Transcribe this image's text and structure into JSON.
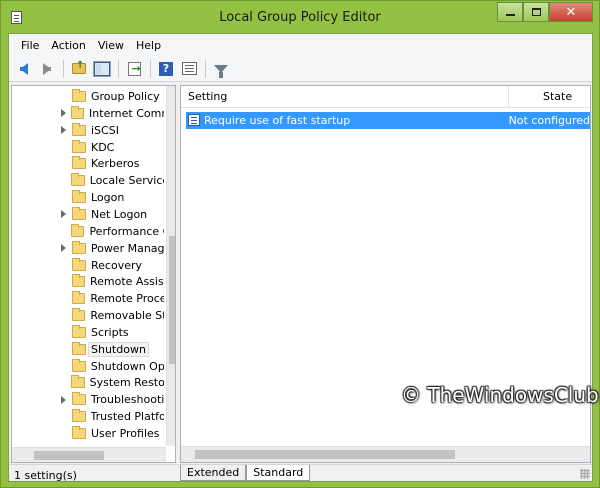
{
  "window": {
    "title": "Local Group Policy Editor"
  },
  "menu": [
    "File",
    "Action",
    "View",
    "Help"
  ],
  "toolbar": {
    "back_icon": "back-arrow-icon",
    "forward_icon": "forward-arrow-icon",
    "up_icon": "up-one-level-icon",
    "tree_icon": "show-hide-console-tree-icon",
    "export_icon": "export-list-icon",
    "help_icon": "help-icon",
    "help_glyph": "?",
    "props_icon": "properties-icon",
    "filter_icon": "filter-icon"
  },
  "tree": {
    "items": [
      {
        "label": "Group Policy",
        "has_children": false,
        "selected": false
      },
      {
        "label": "Internet Comm",
        "has_children": true,
        "selected": false
      },
      {
        "label": "iSCSI",
        "has_children": true,
        "selected": false
      },
      {
        "label": "KDC",
        "has_children": false,
        "selected": false
      },
      {
        "label": "Kerberos",
        "has_children": false,
        "selected": false
      },
      {
        "label": "Locale Service",
        "has_children": false,
        "selected": false
      },
      {
        "label": "Logon",
        "has_children": false,
        "selected": false
      },
      {
        "label": "Net Logon",
        "has_children": true,
        "selected": false
      },
      {
        "label": "Performance C",
        "has_children": false,
        "selected": false
      },
      {
        "label": "Power Manag",
        "has_children": true,
        "selected": false
      },
      {
        "label": "Recovery",
        "has_children": false,
        "selected": false
      },
      {
        "label": "Remote Assist",
        "has_children": false,
        "selected": false
      },
      {
        "label": "Remote Proce",
        "has_children": false,
        "selected": false
      },
      {
        "label": "Removable St",
        "has_children": false,
        "selected": false
      },
      {
        "label": "Scripts",
        "has_children": false,
        "selected": false
      },
      {
        "label": "Shutdown",
        "has_children": false,
        "selected": true
      },
      {
        "label": "Shutdown Op",
        "has_children": false,
        "selected": false
      },
      {
        "label": "System Restor",
        "has_children": false,
        "selected": false
      },
      {
        "label": "Troubleshooti",
        "has_children": true,
        "selected": false
      },
      {
        "label": "Trusted Platfo",
        "has_children": false,
        "selected": false
      },
      {
        "label": "User Profiles",
        "has_children": false,
        "selected": false
      }
    ]
  },
  "list": {
    "columns": {
      "setting": "Setting",
      "state": "State"
    },
    "rows": [
      {
        "setting": "Require use of fast startup",
        "state": "Not configured",
        "selected": true
      }
    ]
  },
  "tabs": [
    "Extended",
    "Standard"
  ],
  "active_tab": "Standard",
  "status": "1 setting(s)",
  "watermark": "© TheWindowsClub",
  "colors": {
    "selection": "#3399ff",
    "frame": "#93c144"
  }
}
